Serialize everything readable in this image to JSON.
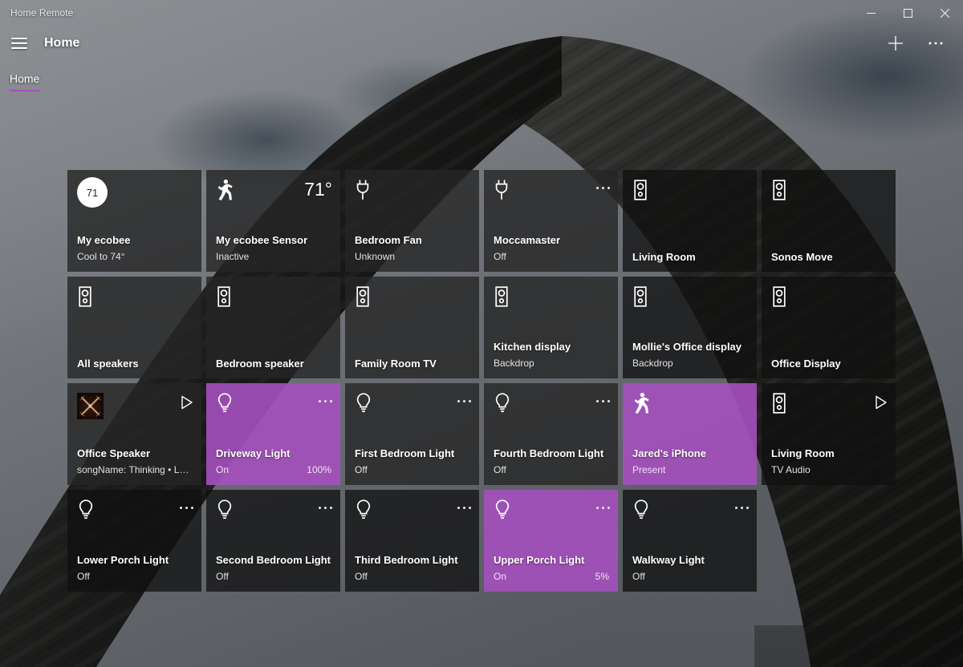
{
  "window": {
    "title": "Home Remote",
    "controls": [
      {
        "name": "minimize-button",
        "glyph": "minimize"
      },
      {
        "name": "maximize-button",
        "glyph": "maximize"
      },
      {
        "name": "close-button",
        "glyph": "close"
      }
    ]
  },
  "header": {
    "menu_icon": "hamburger-icon",
    "page_title": "Home",
    "add_label": "+",
    "more_label": "…"
  },
  "tabs": [
    {
      "label": "Home",
      "selected": true
    }
  ],
  "accent_color": "#a550be",
  "tiles": [
    {
      "name": "My ecobee",
      "status": "Cool to 74°",
      "value": "",
      "icon": "thermostat-circle",
      "badge": "71",
      "state": "off",
      "overflow": false,
      "play": false
    },
    {
      "name": "My ecobee Sensor",
      "status": "Inactive",
      "value": "",
      "icon": "motion-icon",
      "temp": "71°",
      "state": "off",
      "overflow": false,
      "play": false
    },
    {
      "name": "Bedroom Fan",
      "status": "Unknown",
      "value": "",
      "icon": "plug-icon",
      "state": "off",
      "overflow": false,
      "play": false
    },
    {
      "name": "Moccamaster",
      "status": "Off",
      "value": "",
      "icon": "plug-icon",
      "state": "off",
      "overflow": true,
      "play": false
    },
    {
      "name": "Living Room",
      "status": "",
      "value": "",
      "icon": "speaker-icon",
      "state": "dark",
      "overflow": false,
      "play": false
    },
    {
      "name": "Sonos Move",
      "status": "",
      "value": "",
      "icon": "speaker-icon",
      "state": "dark",
      "overflow": false,
      "play": false
    },
    {
      "name": "All speakers",
      "status": "",
      "value": "",
      "icon": "speaker-icon",
      "state": "off",
      "overflow": false,
      "play": false
    },
    {
      "name": "Bedroom speaker",
      "status": "",
      "value": "",
      "icon": "speaker-icon",
      "state": "off",
      "overflow": false,
      "play": false
    },
    {
      "name": "Family Room TV",
      "status": "",
      "value": "",
      "icon": "speaker-icon",
      "state": "off",
      "overflow": false,
      "play": false
    },
    {
      "name": "Kitchen display",
      "status": "Backdrop",
      "value": "",
      "icon": "speaker-icon",
      "state": "off",
      "overflow": false,
      "play": false
    },
    {
      "name": "Mollie's Office display",
      "status": "Backdrop",
      "value": "",
      "icon": "speaker-icon",
      "state": "dark",
      "overflow": false,
      "play": false
    },
    {
      "name": "Office Display",
      "status": "",
      "value": "",
      "icon": "speaker-icon",
      "state": "dark",
      "overflow": false,
      "play": false
    },
    {
      "name": "Office Speaker",
      "status": "songName: Thinking • Lo...",
      "value": "",
      "icon": "album-art",
      "state": "off",
      "overflow": false,
      "play": true
    },
    {
      "name": "Driveway Light",
      "status": "On",
      "value": "100%",
      "icon": "bulb-icon",
      "state": "accent",
      "overflow": true,
      "play": false
    },
    {
      "name": "First Bedroom Light",
      "status": "Off",
      "value": "",
      "icon": "bulb-icon",
      "state": "off",
      "overflow": true,
      "play": false
    },
    {
      "name": "Fourth Bedroom Light",
      "status": "Off",
      "value": "",
      "icon": "bulb-icon",
      "state": "off",
      "overflow": true,
      "play": false
    },
    {
      "name": "Jared's iPhone",
      "status": "Present",
      "value": "",
      "icon": "motion-icon",
      "state": "accent",
      "overflow": false,
      "play": false
    },
    {
      "name": "Living Room",
      "status": "TV Audio",
      "value": "",
      "icon": "speaker-icon",
      "state": "dark",
      "overflow": false,
      "play": true
    },
    {
      "name": "Lower Porch Light",
      "status": "Off",
      "value": "",
      "icon": "bulb-icon",
      "state": "dark",
      "overflow": true,
      "play": false
    },
    {
      "name": "Second Bedroom Light",
      "status": "Off",
      "value": "",
      "icon": "bulb-icon",
      "state": "dark",
      "overflow": true,
      "play": false
    },
    {
      "name": "Third Bedroom Light",
      "status": "Off",
      "value": "",
      "icon": "bulb-icon",
      "state": "dark",
      "overflow": true,
      "play": false
    },
    {
      "name": "Upper Porch Light",
      "status": "On",
      "value": "5%",
      "icon": "bulb-icon",
      "state": "accent",
      "overflow": true,
      "play": false
    },
    {
      "name": "Walkway Light",
      "status": "Off",
      "value": "",
      "icon": "bulb-icon",
      "state": "dark",
      "overflow": true,
      "play": false
    }
  ]
}
